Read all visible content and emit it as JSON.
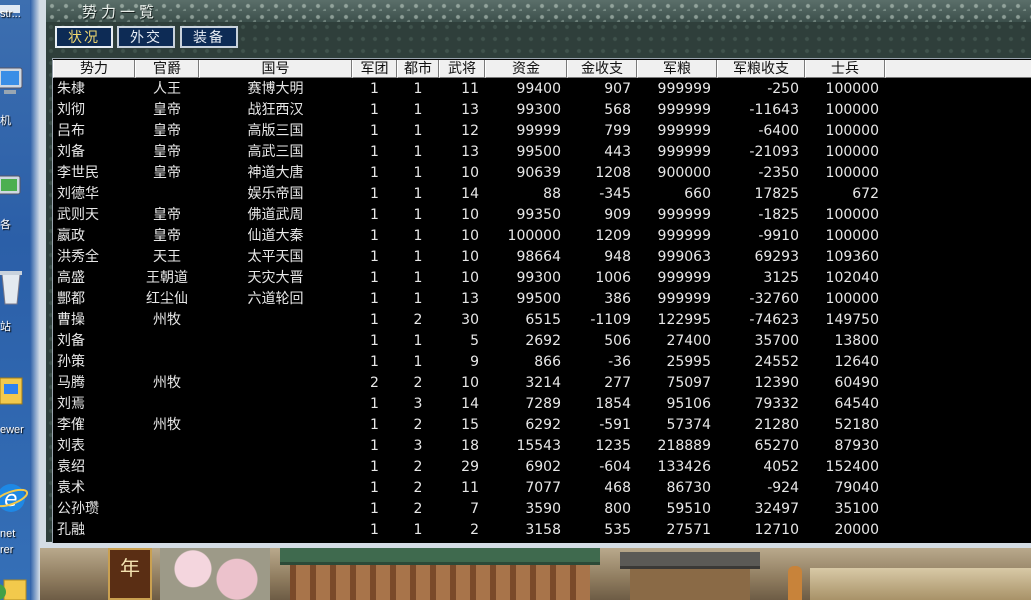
{
  "desktop": {
    "labels": [
      "str...",
      "机",
      "各",
      "站",
      "ewer",
      "net",
      "rer"
    ]
  },
  "window": {
    "title": "势力一覧",
    "tabs": [
      {
        "label": "状况",
        "active": true
      },
      {
        "label": "外交",
        "active": false
      },
      {
        "label": "装备",
        "active": false
      }
    ]
  },
  "table": {
    "headers": [
      "势力",
      "官爵",
      "国号",
      "军团",
      "都市",
      "武将",
      "资金",
      "金收支",
      "军粮",
      "军粮收支",
      "士兵"
    ],
    "rows": [
      [
        "朱棣",
        "人王",
        "赛博大明",
        "1",
        "1",
        "11",
        "99400",
        "907",
        "999999",
        "-250",
        "100000"
      ],
      [
        "刘彻",
        "皇帝",
        "战狂西汉",
        "1",
        "1",
        "13",
        "99300",
        "568",
        "999999",
        "-11643",
        "100000"
      ],
      [
        "吕布",
        "皇帝",
        "高版三国",
        "1",
        "1",
        "12",
        "99999",
        "799",
        "999999",
        "-6400",
        "100000"
      ],
      [
        "刘备",
        "皇帝",
        "高武三国",
        "1",
        "1",
        "13",
        "99500",
        "443",
        "999999",
        "-21093",
        "100000"
      ],
      [
        "李世民",
        "皇帝",
        "神道大唐",
        "1",
        "1",
        "10",
        "90639",
        "1208",
        "900000",
        "-2350",
        "100000"
      ],
      [
        "刘德华",
        "",
        "娱乐帝国",
        "1",
        "1",
        "14",
        "88",
        "-345",
        "660",
        "17825",
        "672"
      ],
      [
        "武则天",
        "皇帝",
        "佛道武周",
        "1",
        "1",
        "10",
        "99350",
        "909",
        "999999",
        "-1825",
        "100000"
      ],
      [
        "嬴政",
        "皇帝",
        "仙道大秦",
        "1",
        "1",
        "10",
        "100000",
        "1209",
        "999999",
        "-9910",
        "100000"
      ],
      [
        "洪秀全",
        "天王",
        "太平天国",
        "1",
        "1",
        "10",
        "98664",
        "948",
        "999063",
        "69293",
        "109360"
      ],
      [
        "高盛",
        "王朝道",
        "天灾大晋",
        "1",
        "1",
        "10",
        "99300",
        "1006",
        "999999",
        "3125",
        "102040"
      ],
      [
        "酆都",
        "红尘仙",
        "六道轮回",
        "1",
        "1",
        "13",
        "99500",
        "386",
        "999999",
        "-32760",
        "100000"
      ],
      [
        "曹操",
        "州牧",
        "",
        "1",
        "2",
        "30",
        "6515",
        "-1109",
        "122995",
        "-74623",
        "149750"
      ],
      [
        "刘备",
        "",
        "",
        "1",
        "1",
        "5",
        "2692",
        "506",
        "27400",
        "35700",
        "13800"
      ],
      [
        "孙策",
        "",
        "",
        "1",
        "1",
        "9",
        "866",
        "-36",
        "25995",
        "24552",
        "12640"
      ],
      [
        "马腾",
        "州牧",
        "",
        "2",
        "2",
        "10",
        "3214",
        "277",
        "75097",
        "12390",
        "60490"
      ],
      [
        "刘焉",
        "",
        "",
        "1",
        "3",
        "14",
        "7289",
        "1854",
        "95106",
        "79332",
        "64540"
      ],
      [
        "李傕",
        "州牧",
        "",
        "1",
        "2",
        "15",
        "6292",
        "-591",
        "57374",
        "21280",
        "52180"
      ],
      [
        "刘表",
        "",
        "",
        "1",
        "3",
        "18",
        "15543",
        "1235",
        "218889",
        "65270",
        "87930"
      ],
      [
        "袁绍",
        "",
        "",
        "1",
        "2",
        "29",
        "6902",
        "-604",
        "133426",
        "4052",
        "152400"
      ],
      [
        "袁术",
        "",
        "",
        "1",
        "2",
        "11",
        "7077",
        "468",
        "86730",
        "-924",
        "79040"
      ],
      [
        "公孙瓒",
        "",
        "",
        "1",
        "2",
        "7",
        "3590",
        "800",
        "59510",
        "32497",
        "35100"
      ],
      [
        "孔融",
        "",
        "",
        "1",
        "1",
        "2",
        "3158",
        "535",
        "27571",
        "12710",
        "20000"
      ]
    ]
  },
  "scenery": {
    "sign_text": "年"
  },
  "colors": {
    "tab_bg": "#0d2b55",
    "tab_active_text": "#f0d870",
    "table_bg": "#000000",
    "table_text": "#e8e8e8",
    "panel_bg": "#2f3f3b"
  }
}
